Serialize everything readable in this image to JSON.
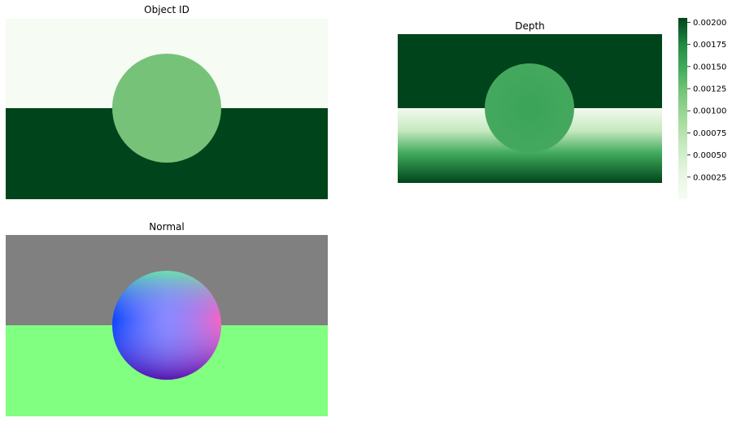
{
  "chart_data": [
    {
      "type": "heatmap",
      "title": "Object ID",
      "colormap": "Greens",
      "regions": [
        {
          "name": "background-top",
          "value": 0,
          "color": "#f6fbf3"
        },
        {
          "name": "floor",
          "value": 2,
          "color": "#00441b"
        },
        {
          "name": "sphere",
          "value": 1,
          "color": "#76c279"
        }
      ]
    },
    {
      "type": "heatmap",
      "title": "Depth",
      "colormap": "Greens",
      "colorbar": {
        "ticks": [
          "0.00025",
          "0.00050",
          "0.00075",
          "0.00100",
          "0.00125",
          "0.00150",
          "0.00175",
          "0.00200"
        ],
        "tick_values": [
          0.00025,
          0.0005,
          0.00075,
          0.001,
          0.00125,
          0.0015,
          0.00175,
          0.002
        ],
        "range": [
          0.0,
          0.00205
        ]
      },
      "colors": {
        "top": "#00441b",
        "floor_near": "#f1faee",
        "floor_far": "#00441b",
        "sphere": "#3ea55b"
      }
    },
    {
      "type": "heatmap",
      "title": "Normal",
      "colors": {
        "top": "#808080",
        "floor": "#80ff80"
      }
    }
  ]
}
